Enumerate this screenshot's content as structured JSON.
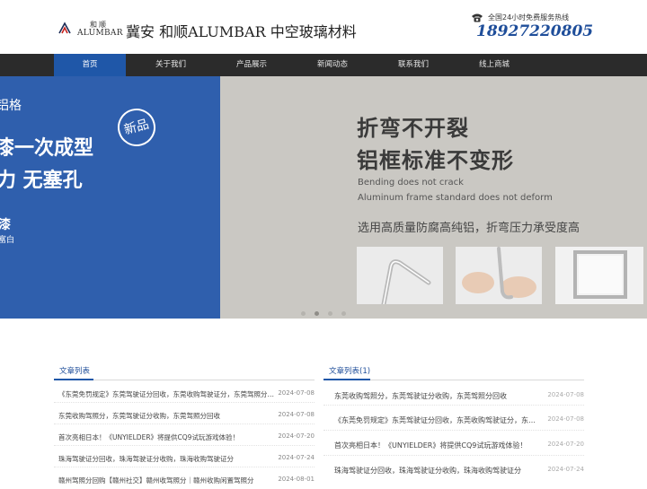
{
  "header": {
    "logo_cn": "和顺",
    "logo_en": "ALUMBAR",
    "site_title": "冀安 和顺ALUMBAR 中空玻璃材料",
    "hotline_label": "全国24小时免费服务热线",
    "hotline_number": "18927220805"
  },
  "nav": {
    "items": [
      {
        "label": "首页",
        "active": true
      },
      {
        "label": "关于我们"
      },
      {
        "label": "产品展示"
      },
      {
        "label": "新闻动态"
      },
      {
        "label": "联系我们"
      },
      {
        "label": "线上商城"
      }
    ]
  },
  "banner": {
    "left_line1": "铝格",
    "left_line2": "漆一次成型",
    "left_line3": "力 无塞孔",
    "left_line4": "漆",
    "left_line5": "富白",
    "badge": "新品",
    "headline1": "折弯不开裂",
    "headline2": "铝框标准不变形",
    "sub_en1": "Bending does not crack",
    "sub_en2": "Aluminum frame standard does not deform",
    "sub_cn": "选用高质量防腐高纯铝，折弯压力承受度高",
    "slide_count": 4,
    "active_slide": 2
  },
  "left_list": {
    "title": "文章列表",
    "rows": [
      {
        "title": "《东莞免罚规定》东莞驾驶证分回收，东莞收购驾驶证分，东莞驾照分回收",
        "date": "2024-07-08"
      },
      {
        "title": "东莞收购驾照分，东莞驾驶证分收购，东莞驾照分回收",
        "date": "2024-07-08"
      },
      {
        "title": "首次亮相日本！《UNYIELDER》将提供CQ9试玩游戏体验！",
        "date": "2024-07-20"
      },
      {
        "title": "珠海驾驶证分回收，珠海驾驶证分收购，珠海收购驾驶证分",
        "date": "2024-07-24"
      },
      {
        "title": "赣州驾照分回购【赣州社交】赣州收驾照分｜赣州收购闲置驾照分",
        "date": "2024-08-01"
      }
    ]
  },
  "right_list": {
    "title": "文章列表(1)",
    "rows": [
      {
        "title": "东莞收购驾照分，东莞驾驶证分收购，东莞驾照分回收",
        "date": "2024-07-08"
      },
      {
        "title": "《东莞免罚规定》东莞驾驶证分回收，东莞收购驾驶证分，东莞驾照分回收",
        "date": "2024-07-08"
      },
      {
        "title": "首次亮相日本！《UNYIELDER》将提供CQ9试玩游戏体验！",
        "date": "2024-07-20"
      },
      {
        "title": "珠海驾驶证分回收，珠海驾驶证分收购，珠海收购驾驶证分",
        "date": "2024-07-24"
      }
    ]
  },
  "colors": {
    "nav_bg": "#2b2b2b",
    "nav_active": "#1f57a8",
    "banner_blue": "#2f5fad",
    "brand_blue": "#1f4e9a"
  },
  "icons": [
    "logo-mark",
    "phone-icon"
  ]
}
